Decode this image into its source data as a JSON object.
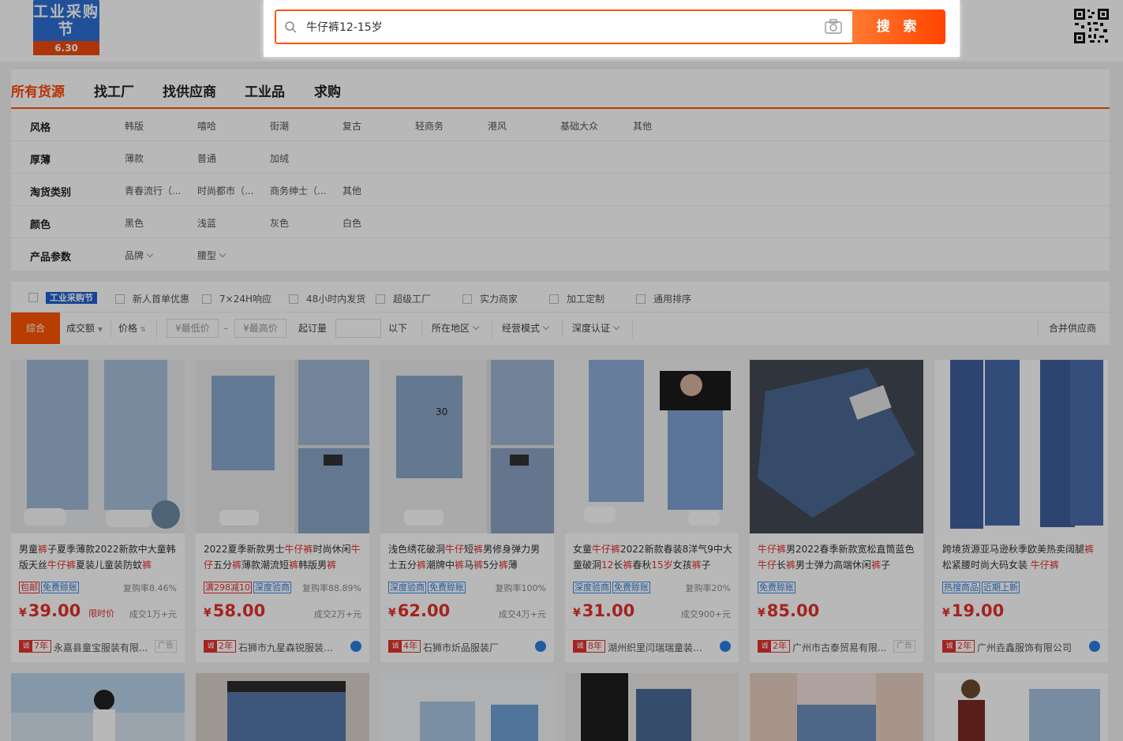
{
  "header": {
    "logo_text_top": "工业采购节",
    "logo_text_bottom": "6.30",
    "search_value": "牛仔裤12-15岁",
    "search_button": "搜 索"
  },
  "nav": {
    "tabs": [
      "所有货源",
      "找工厂",
      "找供应商",
      "工业品",
      "求购"
    ]
  },
  "filters": [
    {
      "label": "风格",
      "options": [
        "韩版",
        "嘻哈",
        "街潮",
        "复古",
        "轻商务",
        "港风",
        "基础大众",
        "其他"
      ]
    },
    {
      "label": "厚薄",
      "options": [
        "薄款",
        "普通",
        "加绒"
      ]
    },
    {
      "label": "淘货类别",
      "options": [
        "青春流行（...",
        "时尚都市（...",
        "商务绅士（...",
        "其他"
      ]
    },
    {
      "label": "颜色",
      "options": [
        "黑色",
        "浅蓝",
        "灰色",
        "白色"
      ]
    },
    {
      "label": "产品参数",
      "options": [
        "品牌",
        "腰型"
      ]
    }
  ],
  "checks": {
    "brand": "工业采购节",
    "items": [
      "新人首单优惠",
      "7×24H响应",
      "48小时内发货",
      "超级工厂",
      "实力商家",
      "加工定制",
      "通用排序"
    ]
  },
  "sort": {
    "comprehensive": "综合",
    "sales": "成交额",
    "price": "价格",
    "min_price": "¥最低价",
    "dash": "–",
    "max_price": "¥最高价",
    "moq": "起订量",
    "below": "以下",
    "region": "所在地区",
    "mode": "经营模式",
    "cert": "深度认证",
    "merge": "合并供应商"
  },
  "products": [
    {
      "title_parts": [
        "男童",
        "裤",
        "子夏季薄款2022新款中大童韩版天丝",
        "牛仔裤",
        "夏装儿童装防蚊",
        "裤"
      ],
      "tags": [
        "包邮",
        "免费赊账"
      ],
      "tag_red": [
        true,
        false
      ],
      "repurchase": "复购率8.46%",
      "price": "39.00",
      "time_price": "限时价",
      "deal": "成交1万+元",
      "years": "7年",
      "shop": "永嘉县童宝服装有限...",
      "ad": "广告"
    },
    {
      "title_parts": [
        "2022夏季新款男士",
        "牛仔裤",
        "时尚休闲",
        "牛仔",
        "五分",
        "裤",
        "薄款潮流短",
        "裤",
        "韩版男",
        "裤"
      ],
      "tags": [
        "满298减10",
        "深度验商"
      ],
      "tag_red": [
        true,
        false
      ],
      "repurchase": "复购率88.89%",
      "price": "58.00",
      "time_price": "",
      "deal": "成交2万+元",
      "years": "2年",
      "shop": "石狮市九星森锐服装商行",
      "ad": ""
    },
    {
      "title_parts": [
        "浅色绣花破洞",
        "牛仔",
        "短",
        "裤",
        "男修身弹力男士五分",
        "裤",
        "潮牌中",
        "裤",
        "马",
        "裤",
        "5分",
        "裤",
        "薄"
      ],
      "tags": [
        "深度验商",
        "免费赊账"
      ],
      "tag_red": [
        false,
        false
      ],
      "repurchase": "复购率100%",
      "price": "62.00",
      "time_price": "",
      "deal": "成交4万+元",
      "years": "4年",
      "shop": "石狮市炘品服装厂",
      "ad": ""
    },
    {
      "title_parts": [
        "女童",
        "牛仔裤",
        "2022新款春装8洋气9中大童破洞",
        "12",
        "长",
        "裤",
        "春秋",
        "15岁",
        "女孩",
        "裤",
        "子"
      ],
      "tags": [
        "深度验商",
        "免费赊账"
      ],
      "tag_red": [
        false,
        false
      ],
      "repurchase": "复购率20%",
      "price": "31.00",
      "time_price": "",
      "deal": "成交900+元",
      "years": "8年",
      "shop": "湖州织里闫瑞瑞童装经...",
      "ad": ""
    },
    {
      "title_parts": [
        "牛仔裤",
        "男2022春季新款宽松直筒蓝色",
        "牛仔",
        "长",
        "裤",
        "男士弹力高端休闲",
        "裤",
        "子"
      ],
      "tags": [
        "免费赊账"
      ],
      "tag_red": [
        false
      ],
      "repurchase": "",
      "price": "85.00",
      "time_price": "",
      "deal": "",
      "years": "2年",
      "shop": "广州市古泰贸易有限...",
      "ad": "广告"
    },
    {
      "title_parts": [
        "跨境货源亚马逊秋季欧美热卖阔腿",
        "裤",
        "松紧腰时尚大码女装 ",
        "牛仔裤"
      ],
      "tags": [
        "热搜商品",
        "近期上新"
      ],
      "tag_red": [
        false,
        false
      ],
      "repurchase": "",
      "price": "19.00",
      "time_price": "",
      "deal": "",
      "years": "2年",
      "shop": "广州垚鑫服饰有限公司",
      "ad": ""
    }
  ],
  "colors": {
    "accent": "#ff5500",
    "highlight": "#e4312d",
    "link": "#2c7fe0"
  }
}
